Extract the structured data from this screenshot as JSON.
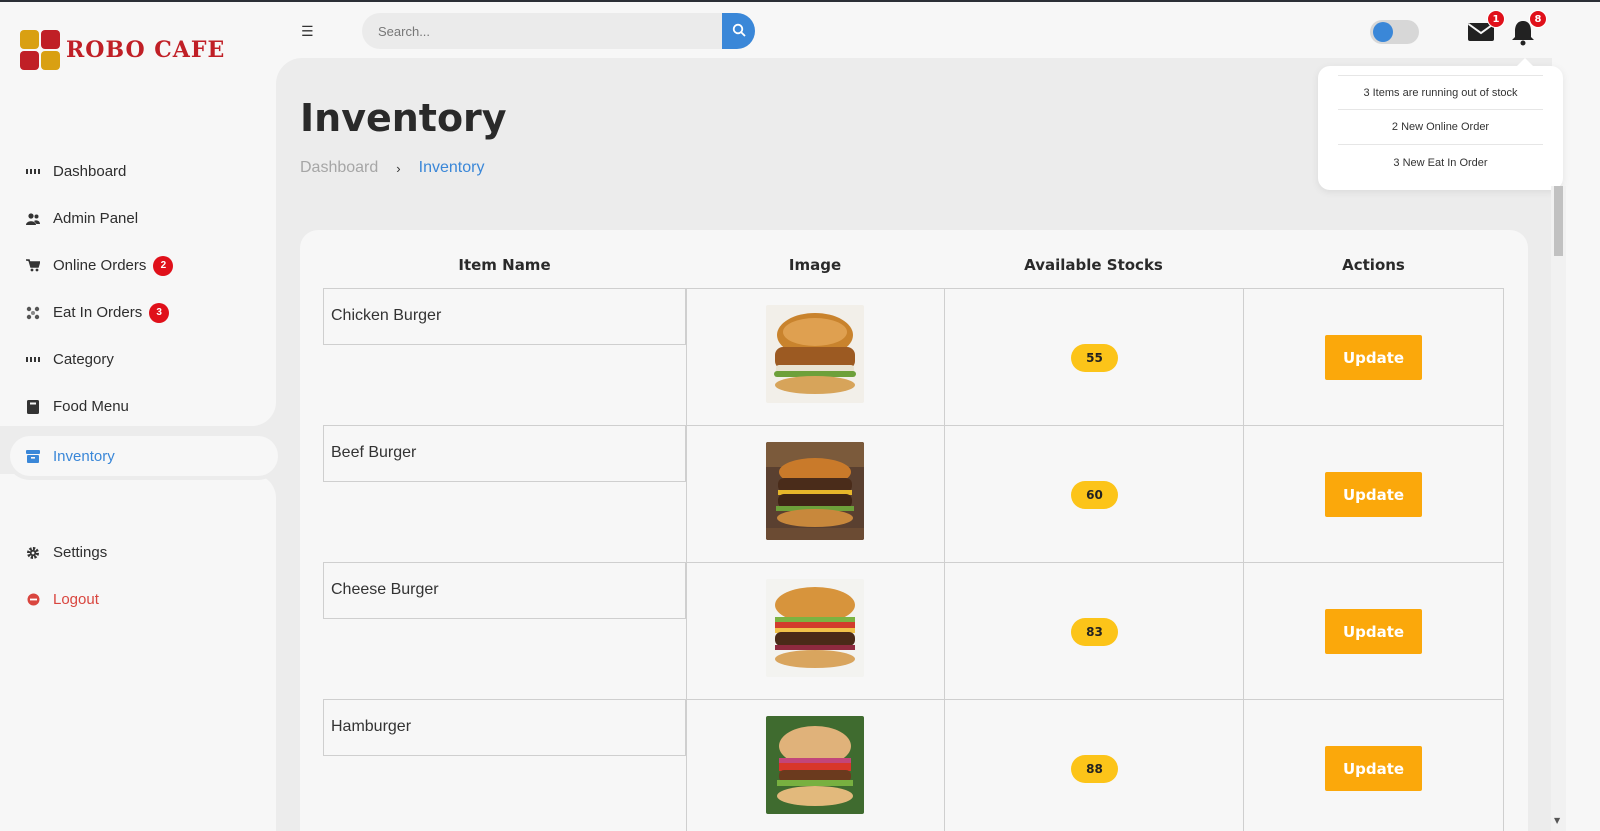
{
  "brand": {
    "name": "ROBO CAFE"
  },
  "sidebar": {
    "items": [
      {
        "label": "Dashboard",
        "icon": "dashboard-icon"
      },
      {
        "label": "Admin Panel",
        "icon": "admin-icon"
      },
      {
        "label": "Online Orders",
        "icon": "cart-icon",
        "badge": "2"
      },
      {
        "label": "Eat In Orders",
        "icon": "dine-icon",
        "badge": "3"
      },
      {
        "label": "Category",
        "icon": "category-icon"
      },
      {
        "label": "Food Menu",
        "icon": "book-icon"
      },
      {
        "label": "Inventory",
        "icon": "archive-icon",
        "active": true
      }
    ],
    "bottom": [
      {
        "label": "Settings",
        "icon": "gear-icon"
      },
      {
        "label": "Logout",
        "icon": "logout-icon"
      }
    ]
  },
  "topbar": {
    "search_placeholder": "Search...",
    "mail_count": "1",
    "notification_count": "8"
  },
  "notifications": [
    "3 Items are running out of stock",
    "2 New Online Order",
    "3 New Eat In Order"
  ],
  "page": {
    "title": "Inventory",
    "breadcrumb": {
      "home": "Dashboard",
      "current": "Inventory"
    }
  },
  "table": {
    "headers": [
      "Item Name",
      "Image",
      "Available Stocks",
      "Actions"
    ],
    "rows": [
      {
        "name": "Chicken Burger",
        "stock": "55",
        "action": "Update"
      },
      {
        "name": "Beef Burger",
        "stock": "60",
        "action": "Update"
      },
      {
        "name": "Cheese Burger",
        "stock": "83",
        "action": "Update"
      },
      {
        "name": "Hamburger",
        "stock": "88",
        "action": "Update"
      }
    ]
  },
  "colors": {
    "accent": "#3a87d8",
    "brand_red": "#c01f26",
    "update_button": "#fba80b",
    "stock_pill": "#fcc419",
    "badge": "#e0101a"
  }
}
